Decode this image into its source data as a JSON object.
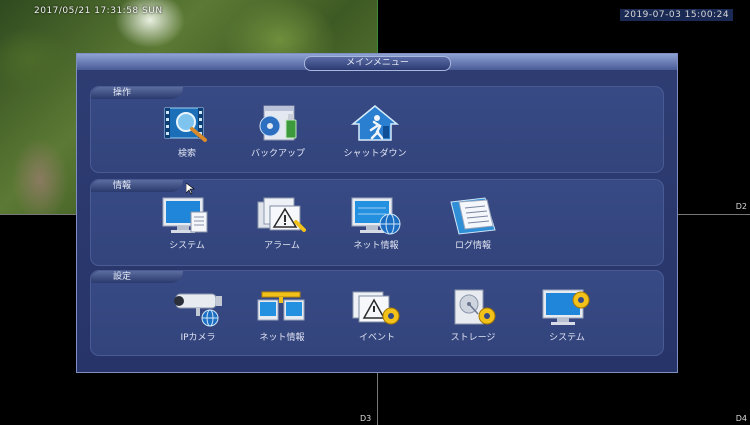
{
  "cameras": {
    "cam1": {
      "timestamp": "2017/05/21 17:31:58 SUN"
    },
    "cam2": {
      "timestamp": "2019-07-03 15:00:24",
      "label": "D2"
    },
    "cam3": {
      "label": "D3"
    },
    "cam4": {
      "label": "D4"
    }
  },
  "menu": {
    "title": "メインメニュー",
    "sections": [
      {
        "label": "操作",
        "items": [
          {
            "label": "検索",
            "icon": "film-search-icon"
          },
          {
            "label": "バックアップ",
            "icon": "usb-backup-icon"
          },
          {
            "label": "シャットダウン",
            "icon": "shutdown-house-icon"
          }
        ]
      },
      {
        "label": "情報",
        "items": [
          {
            "label": "システム",
            "icon": "monitor-document-icon"
          },
          {
            "label": "アラーム",
            "icon": "alarm-warning-icon"
          },
          {
            "label": "ネット情報",
            "icon": "monitor-globe-icon"
          },
          {
            "label": "ログ情報",
            "icon": "log-book-icon"
          }
        ]
      },
      {
        "label": "設定",
        "items": [
          {
            "label": "IPカメラ",
            "icon": "ip-camera-icon"
          },
          {
            "label": "ネット情報",
            "icon": "network-panels-icon"
          },
          {
            "label": "イベント",
            "icon": "event-gear-icon"
          },
          {
            "label": "ストレージ",
            "icon": "storage-gear-icon"
          },
          {
            "label": "システム",
            "icon": "system-gear-icon"
          }
        ]
      }
    ]
  },
  "colors": {
    "menu_bg": "#2e3d73",
    "section_bg": "#384a85",
    "accent": "#8fa2d4",
    "gear_yellow": "#f2c21a"
  }
}
